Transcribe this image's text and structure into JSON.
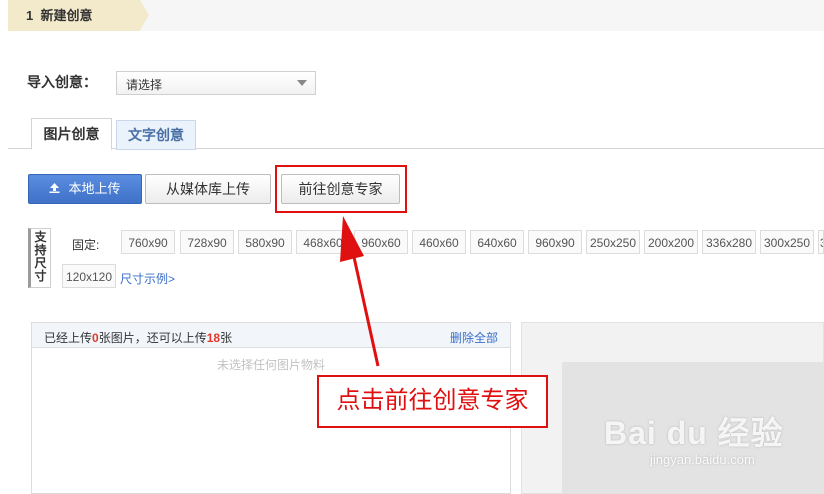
{
  "step": {
    "number": "1",
    "title": "新建创意"
  },
  "import": {
    "label": "导入创意：",
    "select_value": "请选择"
  },
  "tabs": [
    {
      "label": "图片创意",
      "active": true
    },
    {
      "label": "文字创意",
      "active": false
    }
  ],
  "buttons": {
    "local_upload": "本地上传",
    "media_upload": "从媒体库上传",
    "creative_expert": "前往创意专家"
  },
  "sizes": {
    "support_label": [
      "支",
      "持",
      "尺",
      "寸"
    ],
    "fixed_label": "固定:",
    "row1": [
      "760x90",
      "728x90",
      "580x90",
      "468x60",
      "960x60",
      "460x60",
      "640x60",
      "960x90",
      "250x250",
      "200x200",
      "336x280",
      "300x250",
      "3"
    ],
    "row2": [
      "120x120"
    ],
    "example_link": "尺寸示例>"
  },
  "upload_panel": {
    "prefix": "已经上传",
    "uploaded_count": "0",
    "middle": "张图片，还可以上传",
    "remaining_count": "18",
    "suffix": "张",
    "delete_all": "删除全部",
    "empty_hint": "未选择任何图片物料"
  },
  "annotation": {
    "text": "点击前往创意专家",
    "color": "#e01010"
  },
  "watermark": {
    "brand": "Bai du 经验",
    "url": "jingyan.baidu.com"
  },
  "colors": {
    "primary_button": "#4a7fd6",
    "link": "#3a6ec8",
    "count_highlight": "#e0382b",
    "step_bg": "#f3eacb"
  }
}
